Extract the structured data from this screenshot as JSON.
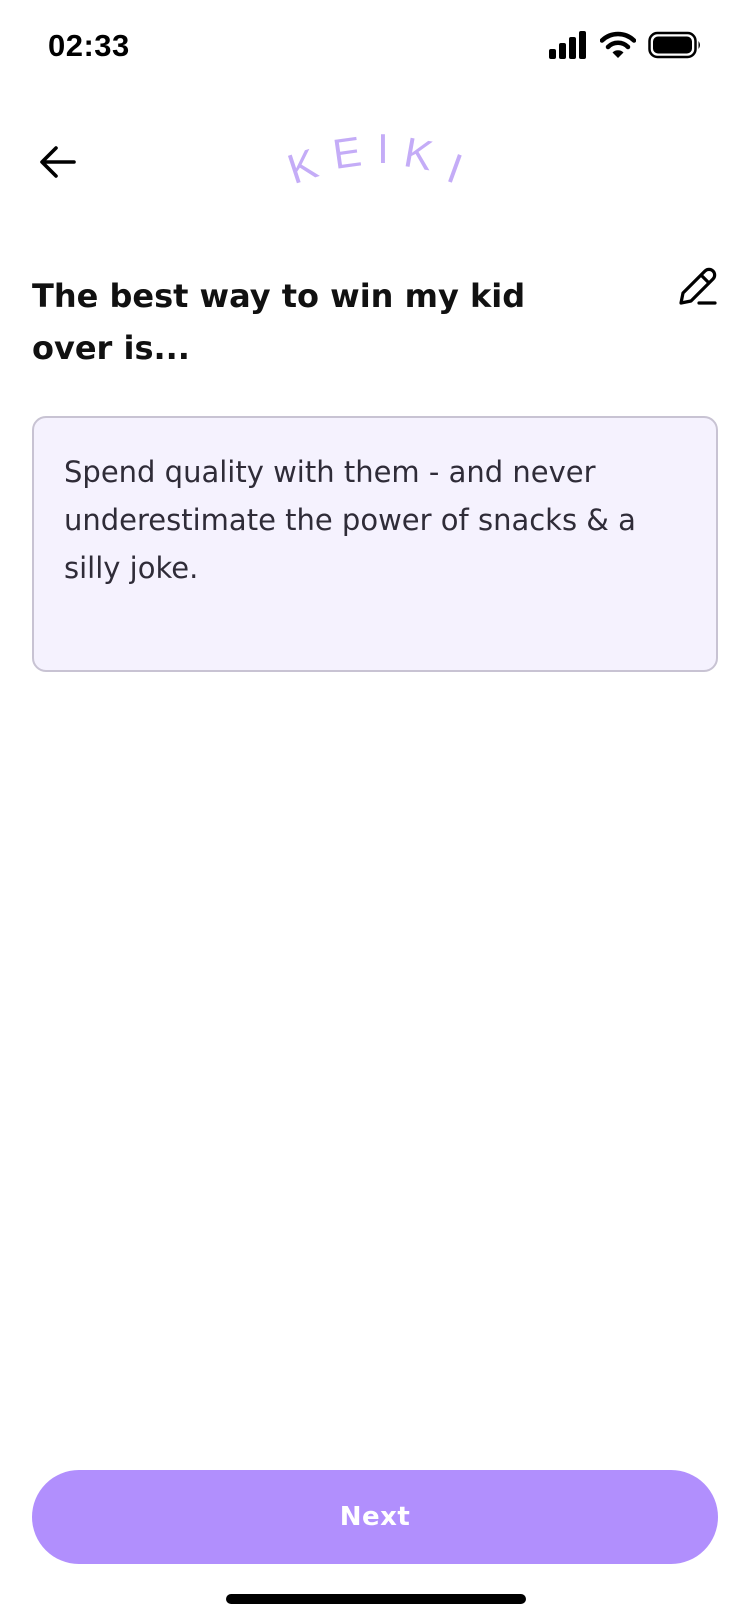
{
  "status_bar": {
    "time": "02:33",
    "icons": [
      "signal-icon",
      "wifi-icon",
      "battery-icon"
    ]
  },
  "header": {
    "back_icon": "arrow-left-icon",
    "logo_text": "KEIKI",
    "logo_letters": [
      "K",
      "E",
      "I",
      "K",
      "I"
    ]
  },
  "prompt": {
    "title": "The best way to win my kid over is...",
    "edit_icon": "pencil-icon"
  },
  "answer": {
    "value": "Spend quality with them - and never underestimate the power of snacks & a silly joke."
  },
  "footer": {
    "next_label": "Next"
  },
  "colors": {
    "accent": "#b18ffd",
    "logo": "#c4acf7",
    "answer_background": "#f5f2fe",
    "answer_border": "#c8c3d3",
    "text": "#111111"
  }
}
